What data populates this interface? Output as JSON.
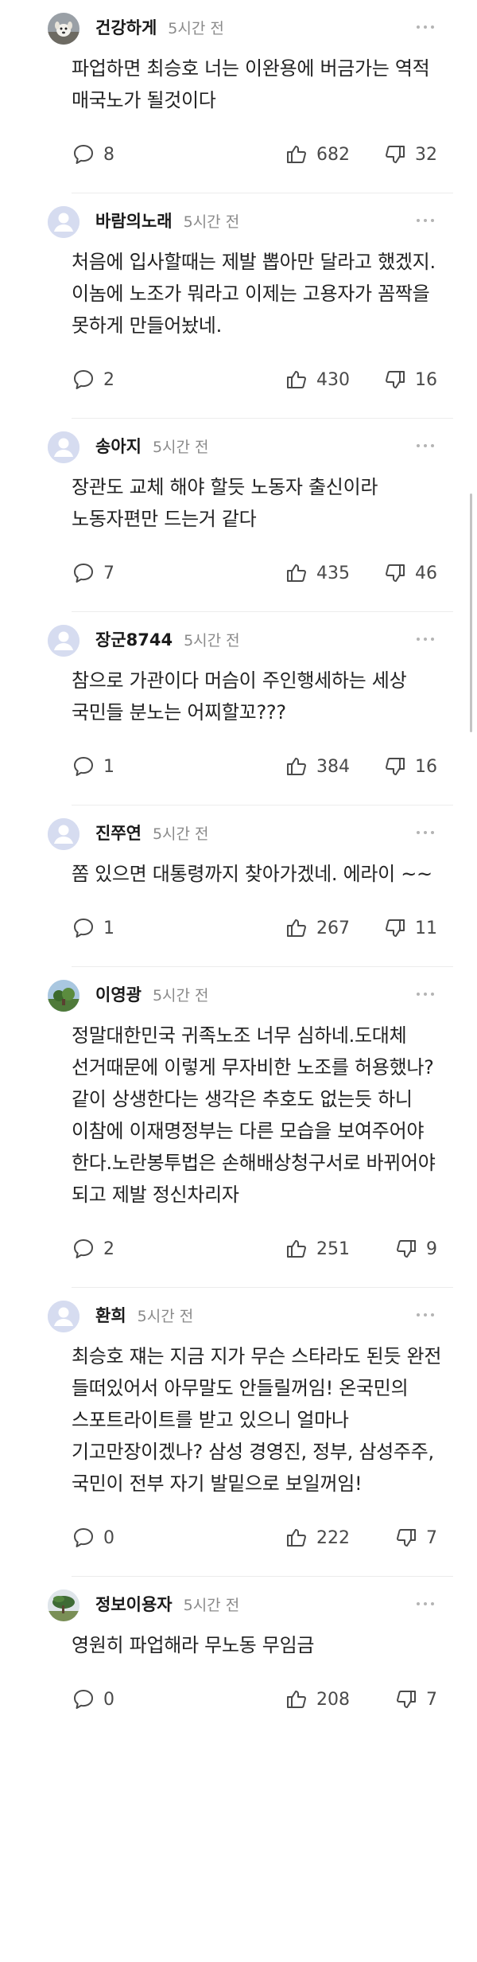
{
  "comments": [
    {
      "author": "건강하게",
      "time": "5시간 전",
      "avatar": "dog-photo",
      "text": "파업하면 최승호 너는 이완용에 버금가는 역적 매국노가 될것이다",
      "replies": "8",
      "likes": "682",
      "dislikes": "32"
    },
    {
      "author": "바람의노래",
      "time": "5시간 전",
      "avatar": "default",
      "text": "처음에 입사할때는 제발 뽑아만 달라고 했겠지. 이놈에 노조가 뭐라고 이제는 고용자가 꼼짝을 못하게 만들어놨네.",
      "replies": "2",
      "likes": "430",
      "dislikes": "16"
    },
    {
      "author": "송아지",
      "time": "5시간 전",
      "avatar": "default",
      "text": "장관도 교체 해야 할듯 노동자 출신이라 노동자편만 드는거 같다",
      "replies": "7",
      "likes": "435",
      "dislikes": "46"
    },
    {
      "author": "장군8744",
      "time": "5시간 전",
      "avatar": "default",
      "text": "참으로 가관이다 머슴이 주인행세하는 세상 국민들 분노는 어찌할꼬???",
      "replies": "1",
      "likes": "384",
      "dislikes": "16"
    },
    {
      "author": "진쭈연",
      "time": "5시간 전",
      "avatar": "default",
      "text": "쫌 있으면 대통령까지 찾아가겠네. 에라이 ~~",
      "replies": "1",
      "likes": "267",
      "dislikes": "11"
    },
    {
      "author": "이영광",
      "time": "5시간 전",
      "avatar": "landscape-photo",
      "text": "정말대한민국 귀족노조 너무 심하네.도대체 선거때문에 이렇게 무자비한 노조를 허용했나?같이 상생한다는 생각은 추호도 없는듯 하니 이참에 이재명정부는 다른 모습을 보여주어야 한다.노란봉투법은 손해배상청구서로 바뀌어야 되고 제발 정신차리자",
      "replies": "2",
      "likes": "251",
      "dislikes": "9"
    },
    {
      "author": "환희",
      "time": "5시간 전",
      "avatar": "default",
      "text": "최승호 쟤는 지금 지가 무슨 스타라도 된듯 완전 들떠있어서 아무말도 안들릴꺼임! 온국민의 스포트라이트를 받고 있으니 얼마나 기고만장이겠나? 삼성 경영진, 정부, 삼성주주, 국민이 전부 자기 발밑으로 보일꺼임!",
      "replies": "0",
      "likes": "222",
      "dislikes": "7"
    },
    {
      "author": "정보이용자",
      "time": "5시간 전",
      "avatar": "tree-photo",
      "text": "영원히 파업해라 무노동 무임금",
      "replies": "0",
      "likes": "208",
      "dislikes": "7"
    }
  ],
  "icons": {
    "reply": "speech-bubble-icon",
    "like": "thumbs-up-icon",
    "dislike": "thumbs-down-icon",
    "more": "more-dots-icon"
  },
  "colors": {
    "avatar_default_bg": "#d6dcf0",
    "avatar_default_fg": "#ffffff",
    "time": "#8a8a8a",
    "icon": "#4a4a4a"
  }
}
